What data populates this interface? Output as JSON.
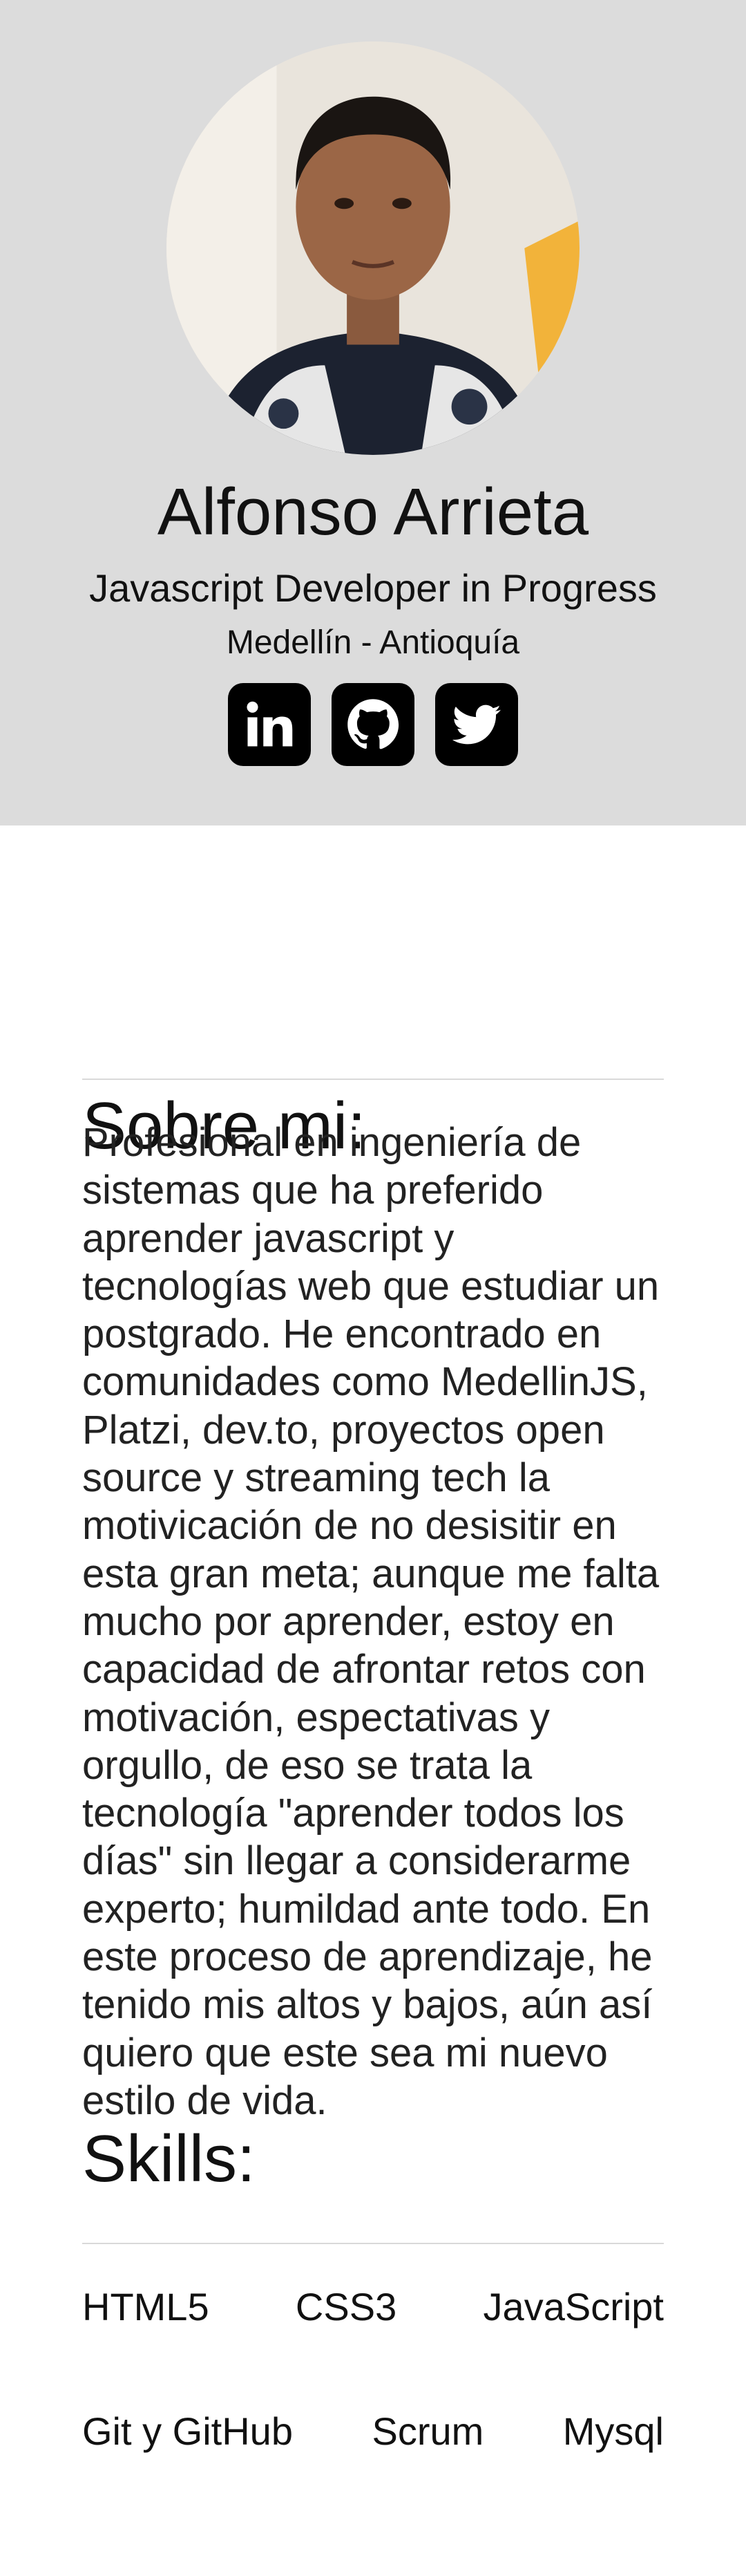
{
  "profile": {
    "name": "Alfonso Arrieta",
    "role": "Javascript Developer in Progress",
    "location": "Medellín - Antioquía"
  },
  "socials": [
    {
      "icon": "linkedin-icon"
    },
    {
      "icon": "github-icon"
    },
    {
      "icon": "twitter-icon"
    }
  ],
  "about": {
    "title": "Sobre mi:",
    "text": "Profesional en ingeniería de sistemas que ha preferido aprender javascript y tecnologías web que estudiar un postgrado. He encontrado en comunidades como MedellinJS, Platzi, dev.to, proyectos open source y streaming tech la motivicación de no desisitir en esta gran meta; aunque me falta mucho por aprender, estoy en capacidad de afrontar retos con motivación, espectativas y orgullo, de eso se trata la tecnología \"aprender todos los días\" sin llegar a considerarme experto; humildad ante todo. En este proceso de aprendizaje, he tenido mis altos y bajos, aún así quiero que este sea mi nuevo estilo de vida."
  },
  "skills": {
    "title": "Skills:",
    "items": [
      "HTML5",
      "CSS3",
      "JavaScript",
      "Git y GitHub",
      "Scrum",
      "Mysql"
    ]
  },
  "colors": {
    "header_bg": "#dcdcdc",
    "icon_bg": "#000000",
    "divider": "#d9d9d9"
  }
}
